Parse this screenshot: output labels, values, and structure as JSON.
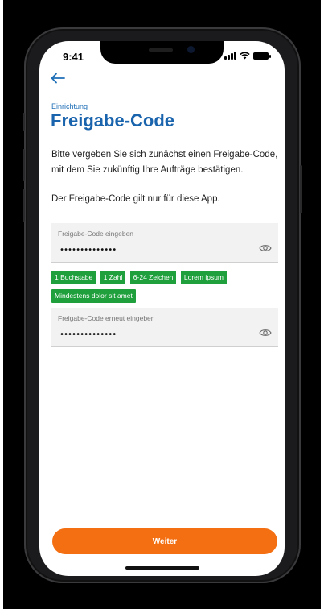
{
  "status_bar": {
    "time": "9:41"
  },
  "header": {
    "eyebrow": "Einrichtung",
    "title": "Freigabe-Code"
  },
  "body": {
    "intro": "Bitte vergeben Sie sich zunächst einen Freigabe-Code, mit dem Sie zukünftig Ihre Aufträge bestätigen.",
    "note": "Der Freigabe-Code gilt nur für diese App."
  },
  "code_field": {
    "label": "Freigabe-Code eingeben",
    "value": "••••••••••••••"
  },
  "requirements": [
    "1 Buchstabe",
    "1 Zahl",
    "6-24 Zeichen",
    "Lorem ipsum",
    "Mindestens dolor sit amet"
  ],
  "confirm_field": {
    "label": "Freigabe-Code erneut eingeben",
    "value": "••••••••••••••"
  },
  "footer": {
    "continue_label": "Weiter"
  },
  "colors": {
    "accent_blue": "#1a64ad",
    "chip_green": "#1fa03c",
    "button_orange": "#f36f11"
  },
  "icons": {
    "back": "arrow-left-icon",
    "reveal": "eye-icon"
  }
}
